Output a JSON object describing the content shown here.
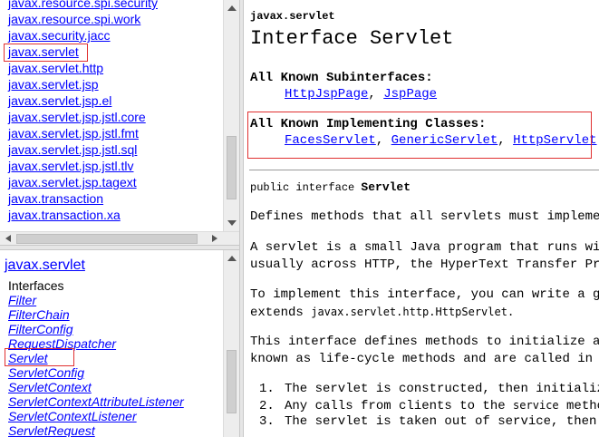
{
  "packages": [
    "javax.resource.spi.security",
    "javax.resource.spi.work",
    "javax.security.jacc",
    "javax.servlet",
    "javax.servlet.http",
    "javax.servlet.jsp",
    "javax.servlet.jsp.el",
    "javax.servlet.jsp.jstl.core",
    "javax.servlet.jsp.jstl.fmt",
    "javax.servlet.jsp.jstl.sql",
    "javax.servlet.jsp.jstl.tlv",
    "javax.servlet.jsp.tagext",
    "javax.transaction",
    "javax.transaction.xa"
  ],
  "class_frame": {
    "package_title": "javax.servlet",
    "interfaces_label": "Interfaces",
    "interfaces": [
      "Filter",
      "FilterChain",
      "FilterConfig",
      "RequestDispatcher",
      "Servlet",
      "ServletConfig",
      "ServletContext",
      "ServletContextAttributeListener",
      "ServletContextListener",
      "ServletRequest"
    ]
  },
  "main": {
    "package_name": "javax.servlet",
    "title": "Interface Servlet",
    "subinterfaces_heading": "All Known Subinterfaces:",
    "subinterfaces": [
      "HttpJspPage",
      "JspPage"
    ],
    "implementing_heading": "All Known Implementing Classes:",
    "implementing": [
      "FacesServlet",
      "GenericServlet",
      "HttpServlet"
    ],
    "separator": ", ",
    "declaration_prefix": "public interface ",
    "declaration_name": "Servlet",
    "p1": "Defines methods that all servlets must implement.",
    "p2_line1": "A servlet is a small Java program that runs withi",
    "p2_line2": "usually across HTTP, the HyperText Transfer Proto",
    "p3_line1": "To implement this interface, you can write a gene",
    "p3_line2_prefix": "extends ",
    "p3_line2_code": "javax.servlet.http.HttpServlet.",
    "p4_line1": "This interface defines methods to initialize a se",
    "p4_line2": "known as life-cycle methods and are called in the",
    "lifecycle": [
      {
        "num": "1.",
        "text": "The servlet is constructed, then initialize",
        "code": ""
      },
      {
        "num": "2.",
        "text": "Any calls from clients to the ",
        "code": "service",
        "after": " method"
      },
      {
        "num": "3.",
        "text": "The servlet is taken out of service, then d",
        "code": ""
      }
    ]
  }
}
